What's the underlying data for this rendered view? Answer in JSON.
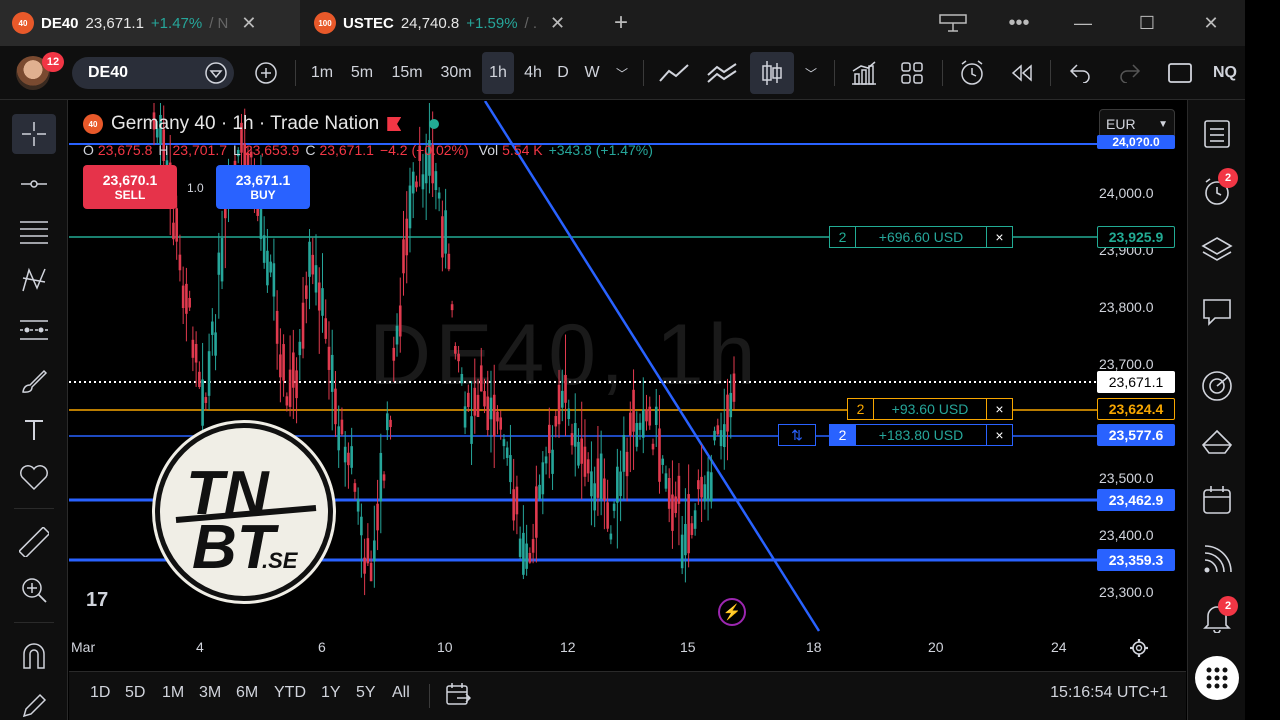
{
  "window": {
    "tabs": [
      {
        "badge": "40",
        "symbol": "DE40",
        "price": "23,671.1",
        "change": "+1.47%",
        "tail": "/ N"
      },
      {
        "badge": "100",
        "symbol": "USTEC",
        "price": "24,740.8",
        "change": "+1.59%",
        "tail": "/ ."
      }
    ],
    "new_tab": "+"
  },
  "toolbar": {
    "notification_count": "12",
    "symbol": "DE40",
    "intervals": [
      "1m",
      "5m",
      "15m",
      "30m",
      "1h",
      "4h",
      "D",
      "W"
    ],
    "active_interval": "1h",
    "right_label": "NQ"
  },
  "chart": {
    "title": "Germany 40 · 1h · Trade Nation",
    "badge": "40",
    "watermark": "DE40, 1h",
    "ohlc": {
      "o_label": "O",
      "o": "23,675.8",
      "h_label": "H",
      "h": "23,701.7",
      "l_label": "L",
      "l": "23,653.9",
      "c_label": "C",
      "c": "23,671.1",
      "change": "−4.2 (−0.02%)",
      "vol_label": "Vol",
      "vol": "5.54 K",
      "vol_change": "+343.8 (+1.47%)"
    },
    "sell": {
      "price": "23,670.1",
      "label": "SELL"
    },
    "buy": {
      "price": "23,671.1",
      "label": "BUY"
    },
    "spread": "1.0",
    "currency": "EUR",
    "price_axis": [
      "24,000.0",
      "23,900.0",
      "23,800.0",
      "23,700.0",
      "23,500.0",
      "23,400.0",
      "23,300.0"
    ],
    "price_tags": [
      {
        "value": "24,0?0.0",
        "color": "#2962ff"
      },
      {
        "value": "23,925.9",
        "color": "#22ab94"
      },
      {
        "value": "23,671.1",
        "color": "#ffffff"
      },
      {
        "value": "23,624.4",
        "color": "#f7a600"
      },
      {
        "value": "23,577.6",
        "color": "#2962ff"
      },
      {
        "value": "23,462.9",
        "color": "#2962ff"
      },
      {
        "value": "23,359.3",
        "color": "#2962ff"
      }
    ],
    "positions": [
      {
        "qty": "2",
        "pnl": "+696.60 USD",
        "close": "×",
        "color": "#22ab94"
      },
      {
        "qty": "2",
        "pnl": "+93.60 USD",
        "close": "×",
        "color": "#f7a600"
      },
      {
        "qty": "2",
        "pnl": "+183.80 USD",
        "close": "×",
        "color": "#2962ff"
      }
    ],
    "reverse_icon": "⇅",
    "x_axis": [
      "Mar",
      "4",
      "6",
      "10",
      "12",
      "15",
      "18",
      "20",
      "24"
    ],
    "logo_text": {
      "line1": "TN",
      "line2": "BT",
      "suffix": ".SE"
    },
    "tv_logo": "17"
  },
  "bottom": {
    "ranges": [
      "1D",
      "5D",
      "1M",
      "3M",
      "6M",
      "YTD",
      "1Y",
      "5Y",
      "All"
    ],
    "clock": "15:16:54 UTC+1"
  },
  "sidebar": {
    "alerts_count": "2",
    "notifications_count": "2"
  }
}
